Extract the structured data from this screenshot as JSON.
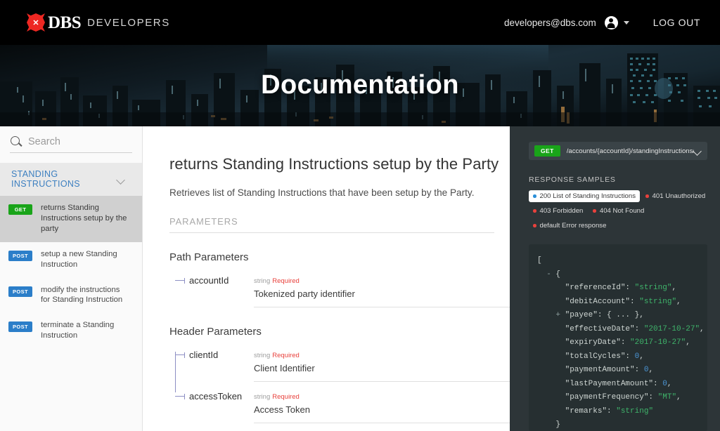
{
  "topbar": {
    "brand_name": "DBS",
    "brand_sub": "DEVELOPERS",
    "user_email": "developers@dbs.com",
    "logout_label": "LOG OUT"
  },
  "hero": {
    "title": "Documentation"
  },
  "sidebar": {
    "search_placeholder": "Search",
    "search_value": "",
    "group_title": "STANDING INSTRUCTIONS",
    "items": [
      {
        "method": "GET",
        "label": "returns Standing Instructions setup by the party",
        "active": true
      },
      {
        "method": "POST",
        "label": "setup a new Standing Instruction",
        "active": false
      },
      {
        "method": "POST",
        "label": "modify the instructions for Standing Instruction",
        "active": false
      },
      {
        "method": "POST",
        "label": "terminate a Standing Instruction",
        "active": false
      }
    ]
  },
  "main": {
    "title": "returns Standing Instructions setup by the Party",
    "description": "Retrieves list of Standing Instructions that have been setup by the Party.",
    "parameters_kicker": "PARAMETERS",
    "groups": [
      {
        "title": "Path Parameters",
        "rows": [
          {
            "name": "accountId",
            "type": "string",
            "required": "Required",
            "desc": "Tokenized party identifier"
          }
        ]
      },
      {
        "title": "Header Parameters",
        "rows": [
          {
            "name": "clientId",
            "type": "string",
            "required": "Required",
            "desc": "Client Identifier"
          },
          {
            "name": "accessToken",
            "type": "string",
            "required": "Required",
            "desc": "Access Token"
          }
        ]
      }
    ]
  },
  "right_panel": {
    "endpoint_method": "GET",
    "endpoint_path": "/accounts/{accountId}/standingInstructions/",
    "samples_kicker": "RESPONSE SAMPLES",
    "sample_tabs": [
      {
        "label": "200 List of Standing Instructions",
        "dot": "blue",
        "active": true
      },
      {
        "label": "401 Unauthorized",
        "dot": "red",
        "active": false
      },
      {
        "label": "403 Forbidden",
        "dot": "red",
        "active": false
      },
      {
        "label": "404 Not Found",
        "dot": "red",
        "active": false
      },
      {
        "label": "default Error response",
        "dot": "red",
        "active": false
      }
    ],
    "code_lines": [
      {
        "indent": 0,
        "parts": [
          {
            "t": "punc",
            "v": "["
          }
        ]
      },
      {
        "indent": 1,
        "parts": [
          {
            "t": "fold",
            "v": "- "
          },
          {
            "t": "punc",
            "v": "{"
          }
        ]
      },
      {
        "indent": 3,
        "parts": [
          {
            "t": "key",
            "v": "\"referenceId\": "
          },
          {
            "t": "str",
            "v": "\"string\""
          },
          {
            "t": "punc",
            "v": ","
          }
        ]
      },
      {
        "indent": 3,
        "parts": [
          {
            "t": "key",
            "v": "\"debitAccount\": "
          },
          {
            "t": "str",
            "v": "\"string\""
          },
          {
            "t": "punc",
            "v": ","
          }
        ]
      },
      {
        "indent": 2,
        "parts": [
          {
            "t": "fold",
            "v": "+ "
          },
          {
            "t": "key",
            "v": "\"payee\": "
          },
          {
            "t": "punc",
            "v": "{ ... },"
          }
        ]
      },
      {
        "indent": 3,
        "parts": [
          {
            "t": "key",
            "v": "\"effectiveDate\": "
          },
          {
            "t": "str",
            "v": "\"2017-10-27\""
          },
          {
            "t": "punc",
            "v": ","
          }
        ]
      },
      {
        "indent": 3,
        "parts": [
          {
            "t": "key",
            "v": "\"expiryDate\": "
          },
          {
            "t": "str",
            "v": "\"2017-10-27\""
          },
          {
            "t": "punc",
            "v": ","
          }
        ]
      },
      {
        "indent": 3,
        "parts": [
          {
            "t": "key",
            "v": "\"totalCycles\": "
          },
          {
            "t": "num",
            "v": "0"
          },
          {
            "t": "punc",
            "v": ","
          }
        ]
      },
      {
        "indent": 3,
        "parts": [
          {
            "t": "key",
            "v": "\"paymentAmount\": "
          },
          {
            "t": "num",
            "v": "0"
          },
          {
            "t": "punc",
            "v": ","
          }
        ]
      },
      {
        "indent": 3,
        "parts": [
          {
            "t": "key",
            "v": "\"lastPaymentAmount\": "
          },
          {
            "t": "num",
            "v": "0"
          },
          {
            "t": "punc",
            "v": ","
          }
        ]
      },
      {
        "indent": 3,
        "parts": [
          {
            "t": "key",
            "v": "\"paymentFrequency\": "
          },
          {
            "t": "str",
            "v": "\"MT\""
          },
          {
            "t": "punc",
            "v": ","
          }
        ]
      },
      {
        "indent": 3,
        "parts": [
          {
            "t": "key",
            "v": "\"remarks\": "
          },
          {
            "t": "str",
            "v": "\"string\""
          }
        ]
      },
      {
        "indent": 2,
        "parts": [
          {
            "t": "punc",
            "v": "}"
          }
        ]
      }
    ]
  },
  "colors": {
    "brand_red": "#ee2722",
    "get_green": "#19a419",
    "post_blue": "#2b7ec9",
    "required_red": "#e8413c",
    "group_link_blue": "#3c7fc0",
    "panel_dark": "#2d3538",
    "code_dark": "#262f31",
    "string_green": "#3fb56b",
    "number_blue": "#4b96d6"
  }
}
